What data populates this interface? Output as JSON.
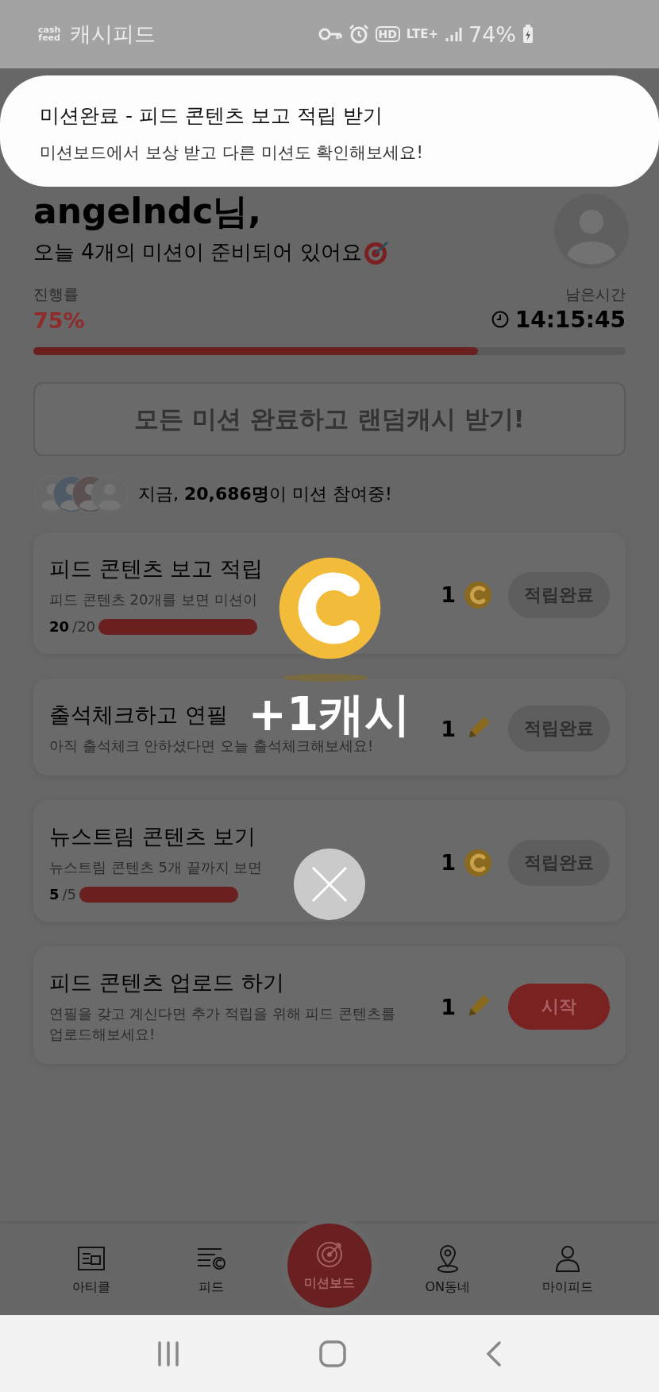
{
  "status_bar": {
    "logo_top": "cash",
    "logo_bottom": "feed",
    "app_name": "캐시피드",
    "hd": "HD",
    "network": "LTE+",
    "battery": "74%"
  },
  "notification": {
    "title": "미션완료 - 피드 콘텐츠 보고 적립 받기",
    "body": "미션보드에서 보상 받고 다른 미션도 확인해보세요!"
  },
  "header": {
    "greeting": "angelndc님,",
    "subtitle": "오늘 4개의 미션이 준비되어 있어요"
  },
  "progress": {
    "label": "진행률",
    "percent": "75%",
    "level": 0.75,
    "time_label": "남은시간",
    "time": "14:15:45"
  },
  "bonus_button": {
    "label": "모든 미션 완료하고 랜덤캐시 받기!"
  },
  "participants": {
    "text": "지금, **20,686명**이 미션 참여중!"
  },
  "missions": [
    {
      "title": "피드 콘텐츠 보고 적립",
      "description": "피드 콘텐츠 20개를 보면 미션이",
      "progress": {
        "done": "20",
        "total": "/20",
        "level": 1
      },
      "reward": {
        "amount": "1",
        "kind": "coin"
      },
      "action": {
        "label": "적립완료",
        "completed": true
      }
    },
    {
      "title": "출석체크하고 연필",
      "description": "아직 출석체크 안하셨다면 오늘 출석체크해보세요!",
      "reward": {
        "amount": "1",
        "kind": "pencil"
      },
      "action": {
        "label": "적립완료",
        "completed": true
      }
    },
    {
      "title": "뉴스트림 콘텐츠 보기",
      "description": "뉴스트림 콘텐츠 5개 끝까지 보면",
      "progress": {
        "done": "5",
        "total": "/5",
        "level": 1
      },
      "reward": {
        "amount": "1",
        "kind": "coin"
      },
      "action": {
        "label": "적립완료",
        "completed": true
      }
    },
    {
      "title": "피드 콘텐츠 업로드 하기",
      "description": "연필을 갖고 계신다면 추가 적립을 위해 피드 콘텐츠를 업로드해보세요!",
      "reward": {
        "amount": "1",
        "kind": "pencil"
      },
      "action": {
        "label": "시작",
        "completed": false
      }
    }
  ],
  "reward_popup": {
    "amount": "+1캐시"
  },
  "nav": [
    {
      "label": "아티클",
      "selected": false
    },
    {
      "label": "피드",
      "selected": false
    },
    {
      "label": "미션보드",
      "selected": true
    },
    {
      "label": "ON동네",
      "selected": false
    },
    {
      "label": "마이피드",
      "selected": false
    }
  ]
}
